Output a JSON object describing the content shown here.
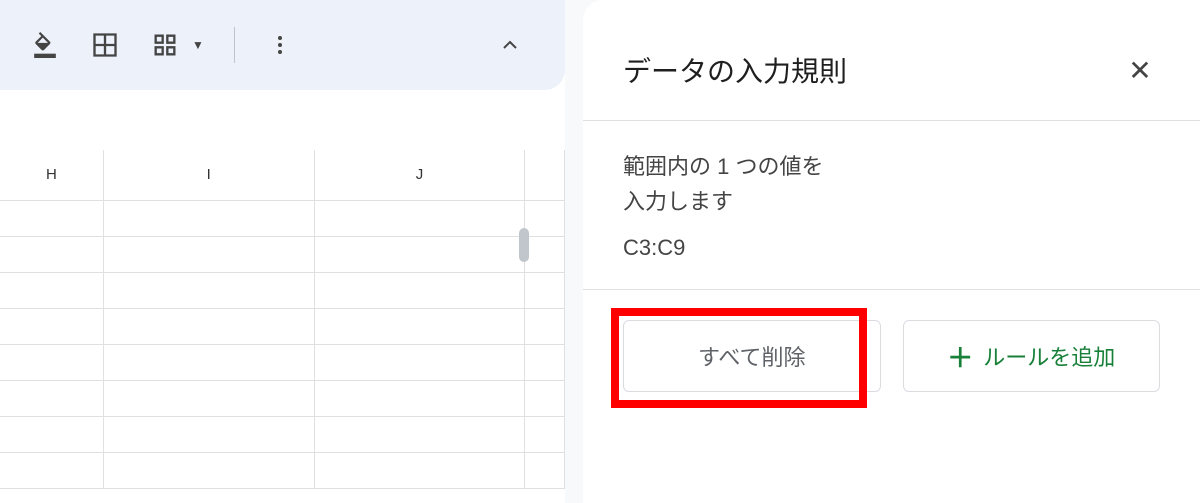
{
  "toolbar": {
    "fill_color": "fill-color",
    "borders": "borders",
    "merge": "merge-cells",
    "more": "more-vert"
  },
  "columns": [
    "H",
    "I",
    "J",
    ""
  ],
  "panel": {
    "title": "データの入力規則",
    "description_line1": "範囲内の 1 つの値を",
    "description_line2": "入力します",
    "range": "C3:C9",
    "delete_all": "すべて削除",
    "add_rule": "ルールを追加",
    "plus": "＋"
  }
}
